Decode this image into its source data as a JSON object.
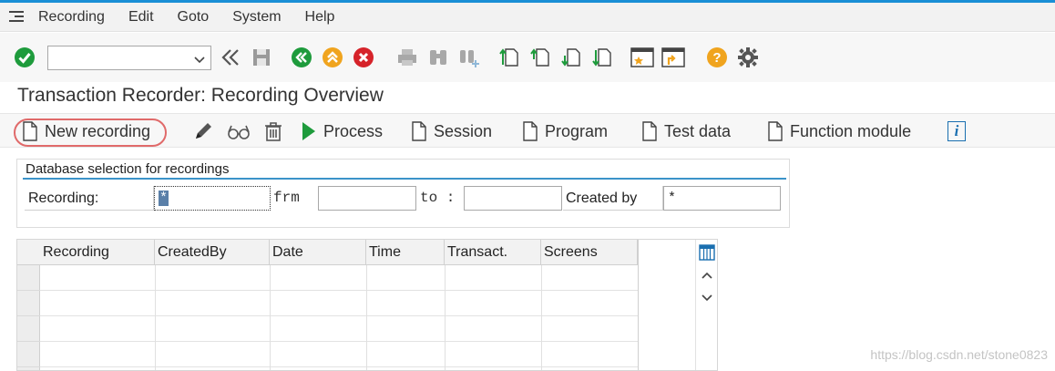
{
  "menu": {
    "items": [
      {
        "label": "Recording"
      },
      {
        "label": "Edit"
      },
      {
        "label": "Goto"
      },
      {
        "label": "System"
      },
      {
        "label": "Help"
      }
    ]
  },
  "toolbar": {
    "command_field_value": ""
  },
  "page": {
    "title": "Transaction Recorder: Recording Overview"
  },
  "app_toolbar": {
    "new_recording": "New recording",
    "process": "Process",
    "session": "Session",
    "program": "Program",
    "test_data": "Test data",
    "function_module": "Function module",
    "info": "i"
  },
  "selection": {
    "header": "Database selection for recordings",
    "recording_label": "Recording:",
    "recording_value": "*",
    "from_label": "frm",
    "from_value": "",
    "to_label": "to :",
    "to_value": "",
    "created_by_label": "Created by",
    "created_by_value": "*"
  },
  "table": {
    "columns": [
      "Recording",
      "CreatedBy",
      "Date",
      "Time",
      "Transact.",
      "Screens"
    ],
    "rows": []
  },
  "watermark": "https://blog.csdn.net/stone0823",
  "colors": {
    "green": "#1e9b3c",
    "orange": "#f0a41e",
    "red": "#d6232a",
    "accent_blue": "#1a8fd6",
    "highlight_red": "#e06a6a"
  }
}
